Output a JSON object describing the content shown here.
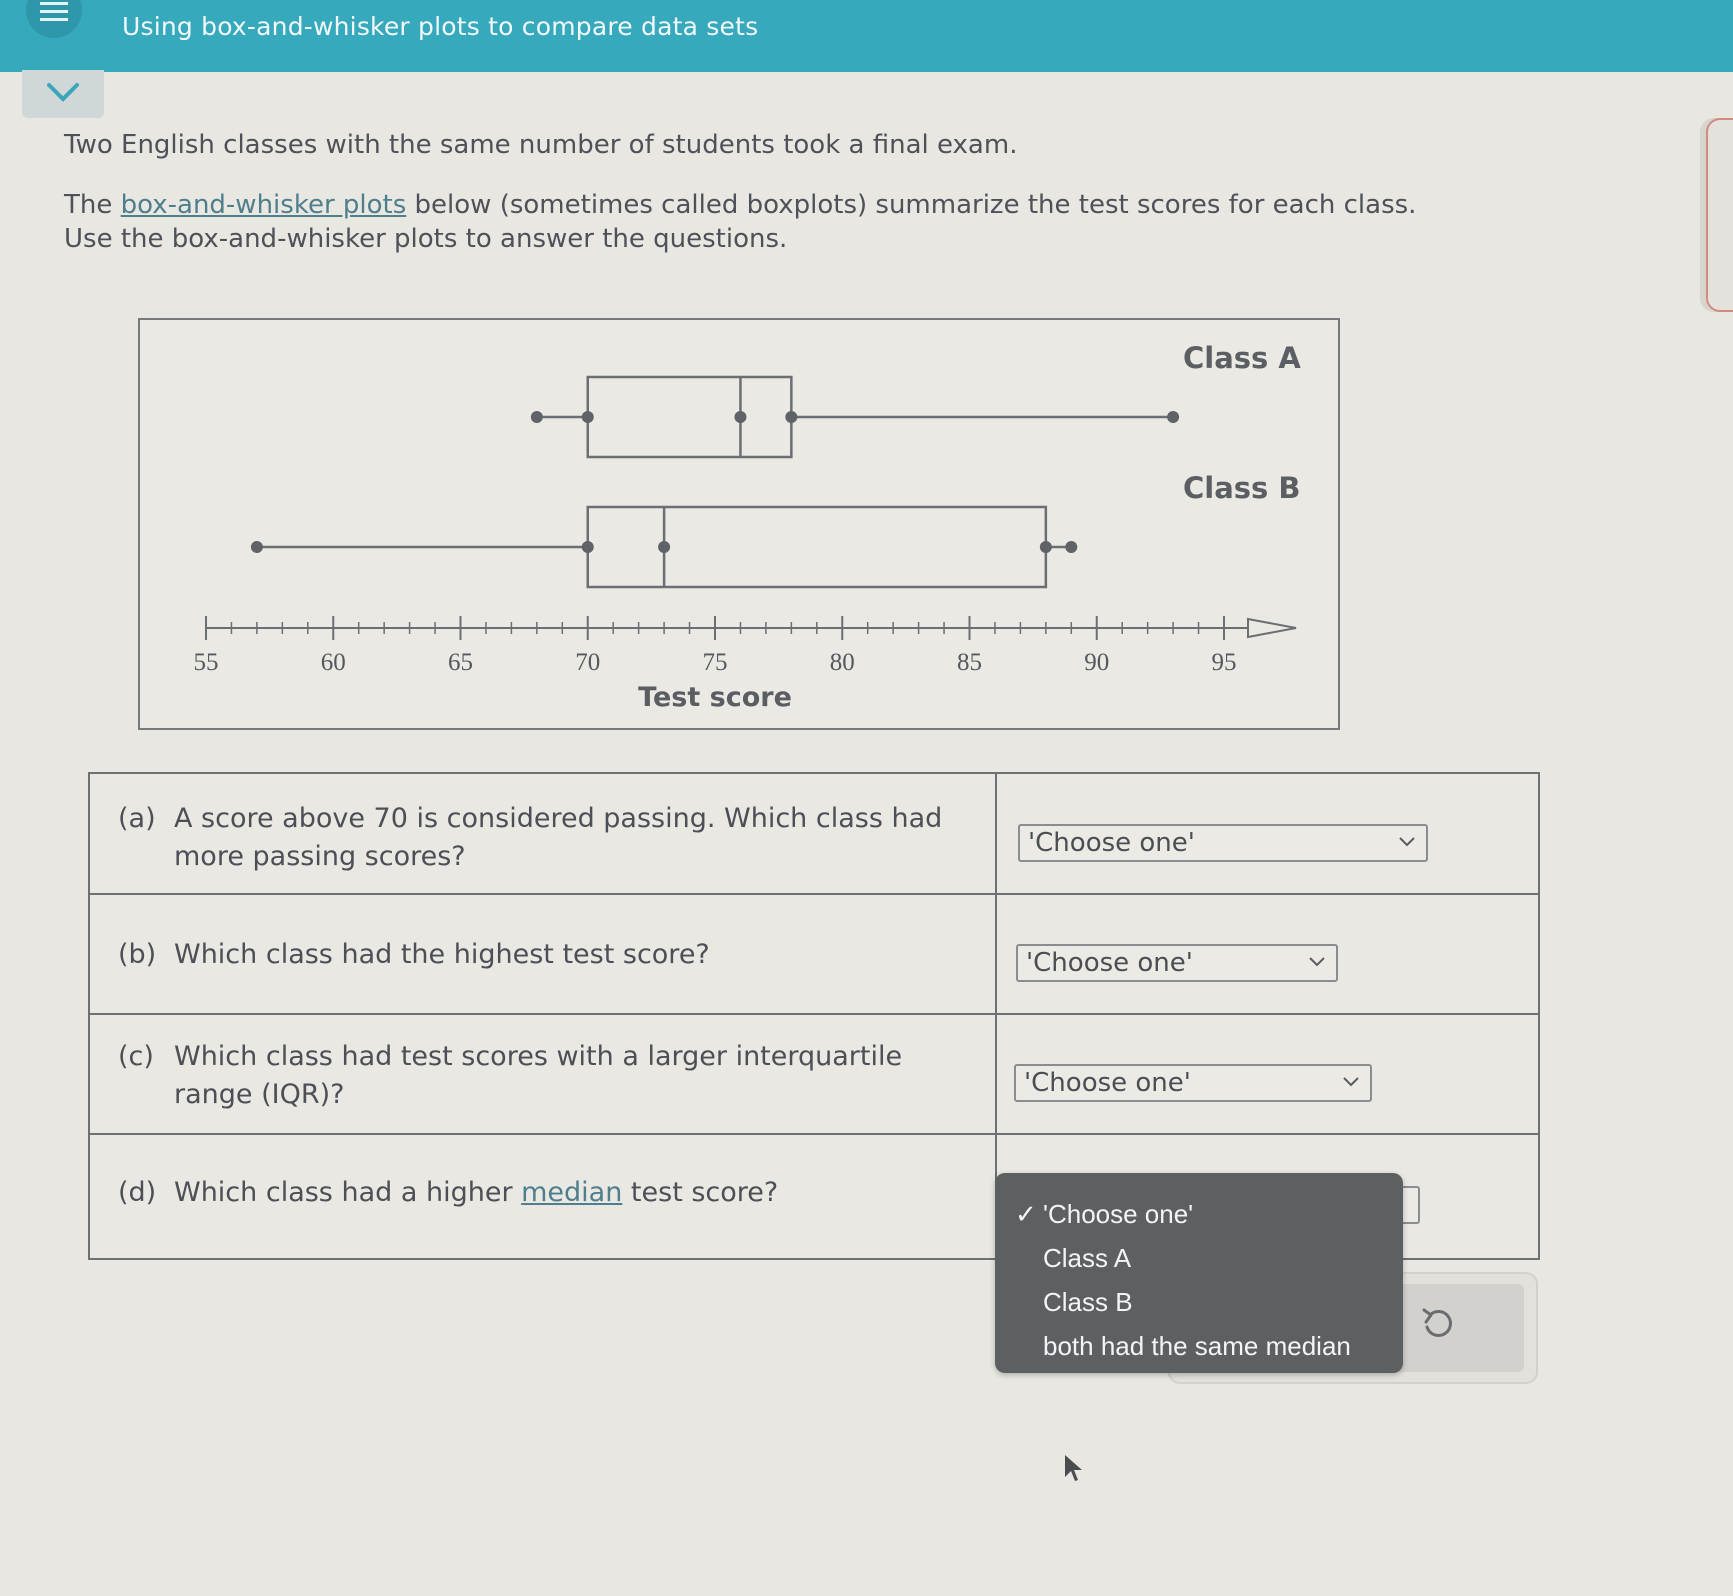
{
  "header": {
    "title": "Using box-and-whisker plots to compare data sets",
    "menu_icon": "hamburger-menu-icon",
    "collapse_icon": "chevron-down-icon",
    "color": "#36a9bd"
  },
  "intro": {
    "line1": "Two English classes with the same number of students took a final exam.",
    "line2_prefix": "The ",
    "line2_link": "box-and-whisker plots",
    "line2_suffix": " below (sometimes called boxplots) summarize the test scores for each class.",
    "line3": "Use the box-and-whisker plots to answer the questions."
  },
  "chart_data": {
    "type": "boxplot",
    "xlabel": "Test score",
    "xlim": [
      55,
      95
    ],
    "major_ticks": [
      55,
      60,
      65,
      70,
      75,
      80,
      85,
      90,
      95
    ],
    "tick_labels": [
      "55",
      "60",
      "65",
      "70",
      "75",
      "80",
      "85",
      "90",
      "95"
    ],
    "minor_tick_step": 1,
    "series": [
      {
        "name": "Class A",
        "min": 68,
        "q1": 70,
        "median": 76,
        "q3": 78,
        "max": 93
      },
      {
        "name": "Class B",
        "min": 57,
        "q1": 70,
        "median": 73,
        "q3": 88,
        "max": 89
      }
    ]
  },
  "questions": [
    {
      "label": "(a)",
      "text_line1": "A score above 70 is considered passing. Which class had",
      "text_line2": "more passing scores?",
      "select_value": "'Choose one'"
    },
    {
      "label": "(b)",
      "text_line1": "Which class had the highest test score?",
      "select_value": "'Choose one'"
    },
    {
      "label": "(c)",
      "text_line1": "Which class had test scores with a larger interquartile",
      "text_line2": "range (IQR)?",
      "select_value": "'Choose one'"
    },
    {
      "label": "(d)",
      "text_prefix": "Which class had a higher ",
      "text_link": "median",
      "text_suffix": " test score?",
      "select_value": "'Choose one'"
    }
  ],
  "dropdown_open": {
    "selected": "'Choose one'",
    "check_glyph": "✓",
    "options": [
      "'Choose one'",
      "Class A",
      "Class B",
      "both had the same median"
    ]
  },
  "actions": {
    "undo_icon": "undo-icon"
  }
}
